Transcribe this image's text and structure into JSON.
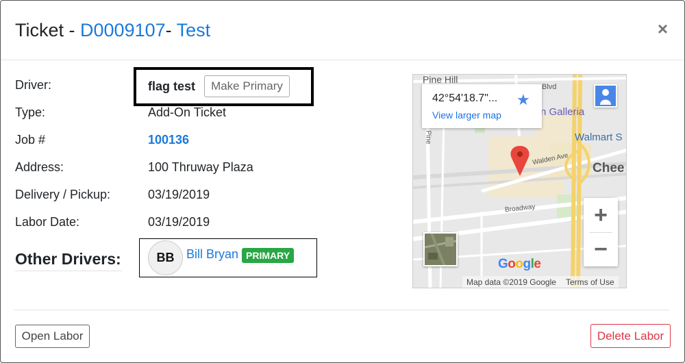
{
  "header": {
    "title_prefix": "Ticket - ",
    "ticket_id": "D0009107",
    "separator": "- ",
    "ticket_name": "Test",
    "close_label": "×"
  },
  "details": {
    "driver_label": "Driver:",
    "driver_name": "flag test",
    "make_primary_label": "Make Primary",
    "type_label": "Type:",
    "type_value": "Add-On Ticket",
    "job_label": "Job #",
    "job_value": "100136",
    "address_label": "Address:",
    "address_value": "100 Thruway Plaza",
    "delivery_label": "Delivery / Pickup:",
    "delivery_value": "03/19/2019",
    "labor_label": "Labor Date:",
    "labor_value": "03/19/2019"
  },
  "other_drivers": {
    "title": "Other Drivers:",
    "items": [
      {
        "initials": "BB",
        "name": "Bill Bryan",
        "badge": "PRIMARY"
      }
    ]
  },
  "map": {
    "coordinates": "42°54'18.7\"...",
    "view_larger": "View larger map",
    "labels": {
      "pine_hill": "Pine Hill",
      "blvd": "Blvd",
      "galleria": "n Galleria",
      "walmart": "Walmart S",
      "chee": "Chee",
      "walden": "Walden Ave",
      "broadway": "Broadway",
      "pine": "Pine"
    },
    "zoom_in": "+",
    "zoom_out": "−",
    "logo": "Google",
    "data_credit": "Map data ©2019 Google",
    "terms": "Terms of Use",
    "colors": {
      "road_yellow": "#f5d26b",
      "pin_red": "#e8453c",
      "area_tan": "#f2e8cf"
    }
  },
  "footer": {
    "open_labor": "Open Labor",
    "delete_labor": "Delete Labor"
  }
}
